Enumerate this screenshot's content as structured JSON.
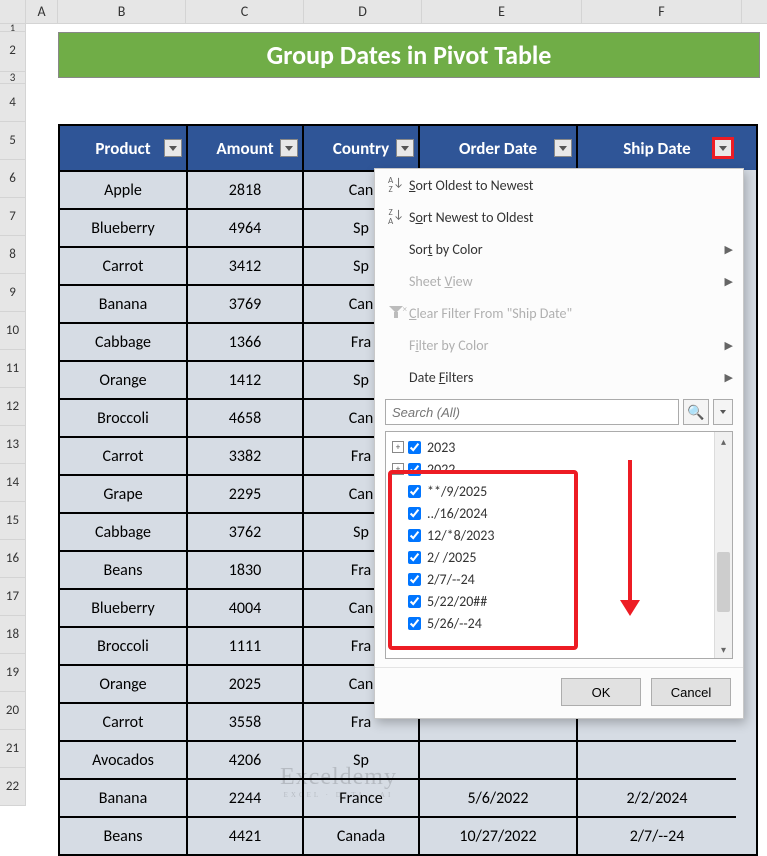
{
  "title": "Group Dates in Pivot Table",
  "columns": [
    "A",
    "B",
    "C",
    "D",
    "E",
    "F"
  ],
  "row_numbers": [
    "1",
    "2",
    "3",
    "4",
    "5",
    "6",
    "7",
    "8",
    "9",
    "10",
    "11",
    "12",
    "13",
    "14",
    "15",
    "16",
    "17",
    "18",
    "19",
    "20",
    "21",
    "22"
  ],
  "headers": {
    "product": "Product",
    "amount": "Amount",
    "country": "Country",
    "order_date": "Order Date",
    "ship_date": "Ship Date"
  },
  "rows": [
    {
      "product": "Apple",
      "amount": "2818",
      "country": "Can",
      "order": "",
      "ship": ""
    },
    {
      "product": "Blueberry",
      "amount": "4964",
      "country": "Sp",
      "order": "",
      "ship": ""
    },
    {
      "product": "Carrot",
      "amount": "3412",
      "country": "Sp",
      "order": "",
      "ship": ""
    },
    {
      "product": "Banana",
      "amount": "3769",
      "country": "Can",
      "order": "",
      "ship": ""
    },
    {
      "product": "Cabbage",
      "amount": "1366",
      "country": "Fra",
      "order": "",
      "ship": ""
    },
    {
      "product": "Orange",
      "amount": "1412",
      "country": "Sp",
      "order": "",
      "ship": ""
    },
    {
      "product": "Broccoli",
      "amount": "4658",
      "country": "Can",
      "order": "",
      "ship": ""
    },
    {
      "product": "Carrot",
      "amount": "3382",
      "country": "Fra",
      "order": "",
      "ship": ""
    },
    {
      "product": "Grape",
      "amount": "2295",
      "country": "Can",
      "order": "",
      "ship": ""
    },
    {
      "product": "Cabbage",
      "amount": "3762",
      "country": "Sp",
      "order": "",
      "ship": ""
    },
    {
      "product": "Beans",
      "amount": "1830",
      "country": "Fra",
      "order": "",
      "ship": ""
    },
    {
      "product": "Blueberry",
      "amount": "4004",
      "country": "Can",
      "order": "",
      "ship": ""
    },
    {
      "product": "Broccoli",
      "amount": "1111",
      "country": "Fra",
      "order": "",
      "ship": ""
    },
    {
      "product": "Orange",
      "amount": "2025",
      "country": "Can",
      "order": "",
      "ship": ""
    },
    {
      "product": "Carrot",
      "amount": "3558",
      "country": "Fra",
      "order": "",
      "ship": ""
    },
    {
      "product": "Avocados",
      "amount": "4206",
      "country": "Sp",
      "order": "",
      "ship": ""
    },
    {
      "product": "Banana",
      "amount": "2244",
      "country": "France",
      "order": "5/6/2022",
      "ship": "2/2/2024"
    },
    {
      "product": "Beans",
      "amount": "4421",
      "country": "Canada",
      "order": "10/27/2022",
      "ship": "2/7/--24"
    }
  ],
  "menu": {
    "sort_oldest": "Sort Oldest to Newest",
    "sort_newest": "Sort Newest to Oldest",
    "sort_color": "Sort by Color",
    "sheet_view": "Sheet View",
    "clear_filter": "Clear Filter From \"Ship Date\"",
    "filter_color": "Filter by Color",
    "date_filters": "Date Filters",
    "search_placeholder": "Search (All)",
    "ok": "OK",
    "cancel": "Cancel"
  },
  "tree": [
    {
      "expand": "+",
      "label": "2023"
    },
    {
      "expand": "+",
      "label": "2022"
    },
    {
      "expand": "",
      "label": "**/9/2025"
    },
    {
      "expand": "",
      "label": "../16/2024"
    },
    {
      "expand": "",
      "label": "12/*8/2023"
    },
    {
      "expand": "",
      "label": "2/  /2025"
    },
    {
      "expand": "",
      "label": "2/7/--24"
    },
    {
      "expand": "",
      "label": "5/22/20##"
    },
    {
      "expand": "",
      "label": "5/26/--24"
    }
  ],
  "watermark": {
    "main": "Exceldemy",
    "sub": "EXCEL · DATA · AI"
  }
}
